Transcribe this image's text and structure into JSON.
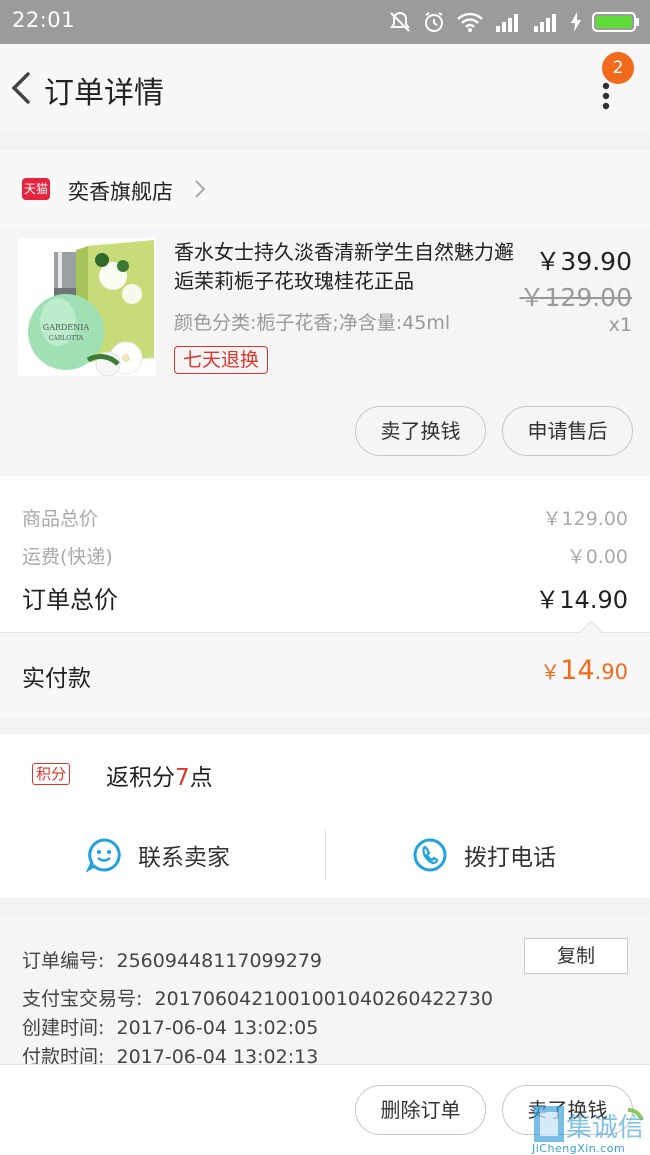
{
  "status_bar": {
    "time": "22:01"
  },
  "header": {
    "title": "订单详情",
    "badge_count": "2"
  },
  "shop": {
    "platform_badge": "天猫",
    "name": "奕香旗舰店"
  },
  "product": {
    "title": "香水女士持久淡香清新学生自然魅力邂逅茉莉栀子花玫瑰桂花正品",
    "attributes": "颜色分类:栀子花香;净含量:45ml",
    "return_tag": "七天退换",
    "price": "￥39.90",
    "original_price": "￥129.00",
    "quantity": "x1",
    "bottle_label_1": "GARDENIA",
    "bottle_label_2": "CARLOTTA",
    "buttons": {
      "sell": "卖了换钱",
      "after_sale": "申请售后"
    }
  },
  "summary": {
    "goods_total_label": "商品总价",
    "goods_total": "￥129.00",
    "shipping_label": "运费(快递)",
    "shipping": "￥0.00",
    "order_total_label": "订单总价",
    "order_total": "￥14.90"
  },
  "paid": {
    "label": "实付款",
    "currency": "￥",
    "int": "14",
    "dec": ".90"
  },
  "points": {
    "tag": "积分",
    "text_prefix": "返积分",
    "count": "7",
    "text_suffix": "点"
  },
  "contact": {
    "seller": "联系卖家",
    "phone": "拨打电话"
  },
  "order_info": {
    "number_label": "订单编号:",
    "number": "25609448117099279",
    "alipay_label": "支付宝交易号:",
    "alipay": "2017060421001001040260422730",
    "created_label": "创建时间:",
    "created": "2017-06-04 13:02:05",
    "paid_label": "付款时间:",
    "paid": "2017-06-04 13:02:13",
    "copy_button": "复制"
  },
  "bottom_bar": {
    "delete": "删除订单",
    "sell": "卖了换钱"
  },
  "watermark": {
    "text": "JiChengXin.com",
    "logo": "集诚信"
  },
  "colors": {
    "accent_orange": "#f26b1d",
    "tmall_red": "#e8233d",
    "tag_red": "#e0352b",
    "contact_blue": "#1fa3e0"
  }
}
